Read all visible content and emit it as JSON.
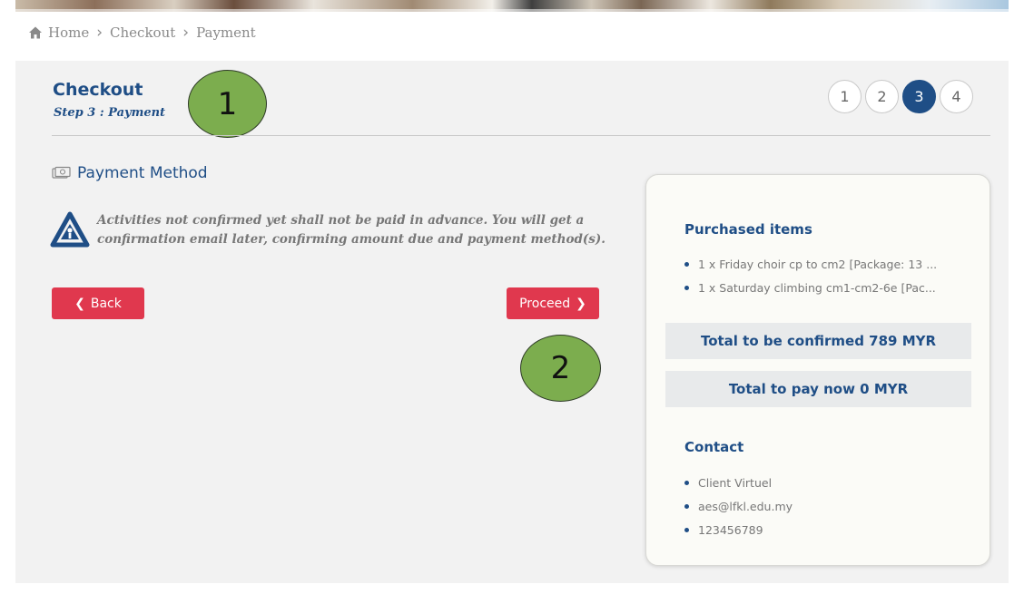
{
  "breadcrumb": {
    "icon": "home-icon",
    "items": [
      "Home",
      "Checkout",
      "Payment"
    ]
  },
  "header": {
    "title": "Checkout",
    "subtitle": "Step 3 : Payment"
  },
  "steps": {
    "items": [
      "1",
      "2",
      "3",
      "4"
    ],
    "active": "3"
  },
  "annotations": [
    "1",
    "2"
  ],
  "payment": {
    "heading": "Payment Method",
    "icon": "money-icon",
    "warning_icon": "warning-icon",
    "warning_text": "Activities not confirmed yet shall not be paid in advance. You will get a confirmation email later, confirming amount due and payment method(s)."
  },
  "buttons": {
    "back_label": "Back",
    "proceed_label": "Proceed"
  },
  "summary": {
    "purchased_heading": "Purchased items",
    "items": [
      "1 x Friday choir cp to cm2 [Package: 13 ...",
      "1 x Saturday climbing cm1-cm2-6e [Pac..."
    ],
    "total_confirmed": "Total to be confirmed 789 MYR",
    "total_paynow": "Total to pay now 0 MYR",
    "contact_heading": "Contact",
    "contacts": [
      "Client Virtuel",
      "aes@lfkl.edu.my",
      "123456789"
    ]
  },
  "colors": {
    "brand": "#1f4e86",
    "button": "#e0384e",
    "annotation": "#7cad4e"
  }
}
